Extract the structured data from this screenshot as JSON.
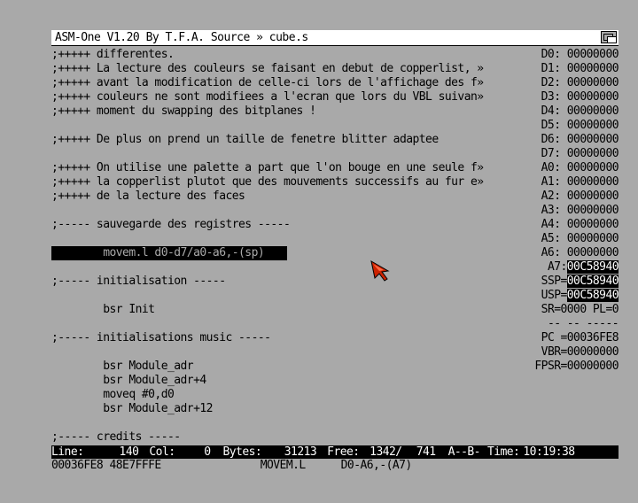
{
  "window": {
    "title": "ASM-One V1.20 By T.F.A. Source » cube.s"
  },
  "editor": {
    "lines": [
      ";+++++ differentes.",
      ";+++++ La lecture des couleurs se faisant en debut de copperlist, »",
      ";+++++ avant la modification de celle-ci lors de l'affichage des f»",
      ";+++++ couleurs ne sont modifiees a l'ecran que lors du VBL suivan»",
      ";+++++ moment du swapping des bitplanes !",
      "",
      ";+++++ De plus on prend un taille de fenetre blitter adaptee",
      "",
      ";+++++ On utilise une palette a part que l'on bouge en une seule f»",
      ";+++++ la copperlist plutot que des mouvements successifs au fur e»",
      ";+++++ de la lecture des faces",
      "",
      ";----- sauvegarde des registres -----",
      "",
      "        movem.l d0-d7/a0-a6,-(sp)",
      "",
      ";----- initialisation -----",
      "",
      "        bsr Init",
      "",
      ";----- initialisations music -----",
      "",
      "        bsr Module_adr",
      "        bsr Module_adr+4",
      "        moveq #0,d0",
      "        bsr Module_adr+12",
      "",
      ";----- credits -----"
    ],
    "highlight_line": 14
  },
  "registers": [
    {
      "label": "D0:",
      "value": "00000000"
    },
    {
      "label": "D1:",
      "value": "00000000"
    },
    {
      "label": "D2:",
      "value": "00000000"
    },
    {
      "label": "D3:",
      "value": "00000000"
    },
    {
      "label": "D4:",
      "value": "00000000"
    },
    {
      "label": "D5:",
      "value": "00000000"
    },
    {
      "label": "D6:",
      "value": "00000000"
    },
    {
      "label": "D7:",
      "value": "00000000"
    },
    {
      "label": "A0:",
      "value": "00000000"
    },
    {
      "label": "A1:",
      "value": "00000000"
    },
    {
      "label": "A2:",
      "value": "00000000"
    },
    {
      "label": "A3:",
      "value": "00000000"
    },
    {
      "label": "A4:",
      "value": "00000000"
    },
    {
      "label": "A5:",
      "value": "00000000"
    },
    {
      "label": "A6:",
      "value": "00000000"
    },
    {
      "label": "A7:",
      "value": "00C58940",
      "inverted": true
    },
    {
      "label": "SSP=",
      "value": "00C58940",
      "inverted": true
    },
    {
      "label": "USP=",
      "value": "00C58940",
      "inverted": true
    },
    {
      "label": "SR=0000 PL=0",
      "value": ""
    },
    {
      "label": "-- -- -----",
      "value": ""
    },
    {
      "label": "PC =00036FE8",
      "value": ""
    },
    {
      "label": "VBR=00000000",
      "value": ""
    },
    {
      "label": "FPSR=00000000",
      "value": ""
    }
  ],
  "status": {
    "line_label": "Line:",
    "line_value": "140",
    "col_label": "Col:",
    "col_value": "0",
    "bytes_label": "Bytes:",
    "bytes_value": "31213",
    "free_label": "Free:",
    "free_value": "1342/",
    "free_value2": "741",
    "flags": "A--B-",
    "time_label": "Time:",
    "time_value": "10:19:38"
  },
  "disasm": {
    "address": "00036FE8",
    "opcode": "48E7FFFE",
    "mnemonic": "MOVEM.L",
    "operands": "D0-A6,-(A7)"
  }
}
